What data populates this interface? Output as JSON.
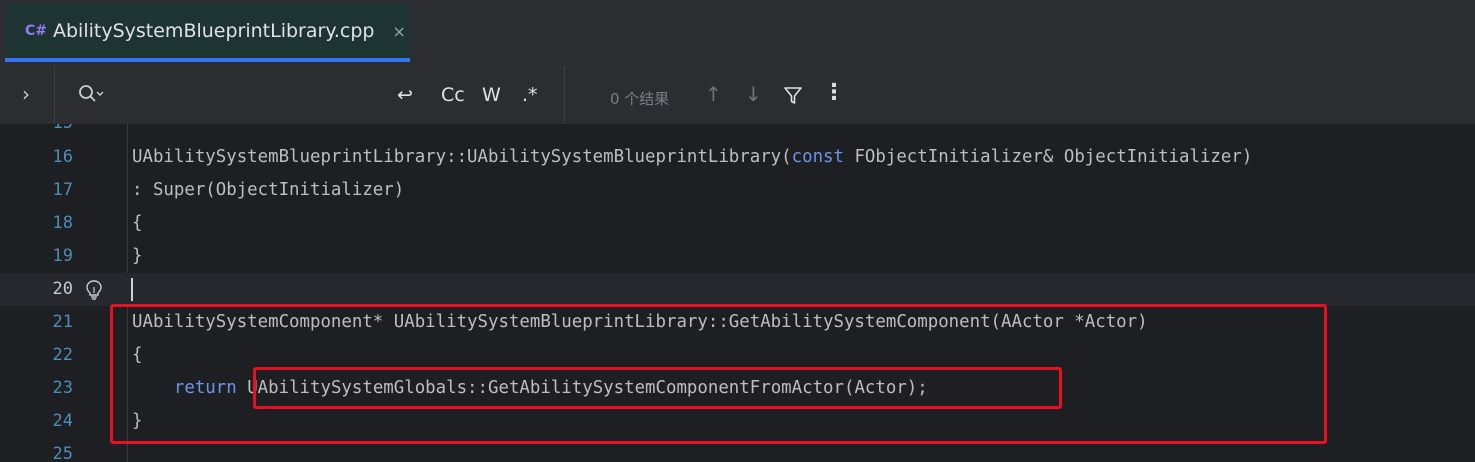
{
  "tab": {
    "icon_text": "C#",
    "title": "AbilitySystemBlueprintLibrary.cpp",
    "close": "×"
  },
  "find": {
    "toggle": "›",
    "search_value": "",
    "options": [
      ".*",
      "W",
      "Cc",
      "↩"
    ],
    "results": "0 个结果",
    "up": "↑",
    "down": "↓",
    "more": "⋮"
  },
  "editor": {
    "lines": [
      {
        "num": "15",
        "code": ""
      },
      {
        "num": "16",
        "code": "UAbilitySystemBlueprintLibrary::UAbilitySystemBlueprintLibrary(",
        "kw": "const",
        "code_after": " FObjectInitializer& ObjectInitializer)"
      },
      {
        "num": "17",
        "code": ": Super(ObjectInitializer)"
      },
      {
        "num": "18",
        "code": "{"
      },
      {
        "num": "19",
        "code": "}"
      },
      {
        "num": "20",
        "code": ""
      },
      {
        "num": "21",
        "code": "UAbilitySystemComponent* UAbilitySystemBlueprintLibrary::GetAbilitySystemComponent(AActor *Actor)"
      },
      {
        "num": "22",
        "code": "{"
      },
      {
        "num": "23",
        "code": "    ",
        "kw": "return",
        "code_after": " UAbilitySystemGlobals::GetAbilitySystemComponentFromActor(Actor);"
      },
      {
        "num": "24",
        "code": "}"
      },
      {
        "num": "25",
        "code": ""
      }
    ],
    "current_line": "20"
  },
  "colors": {
    "highlight_box": "#e81123",
    "keyword": "#6c95eb",
    "accent": "#3574f0"
  }
}
